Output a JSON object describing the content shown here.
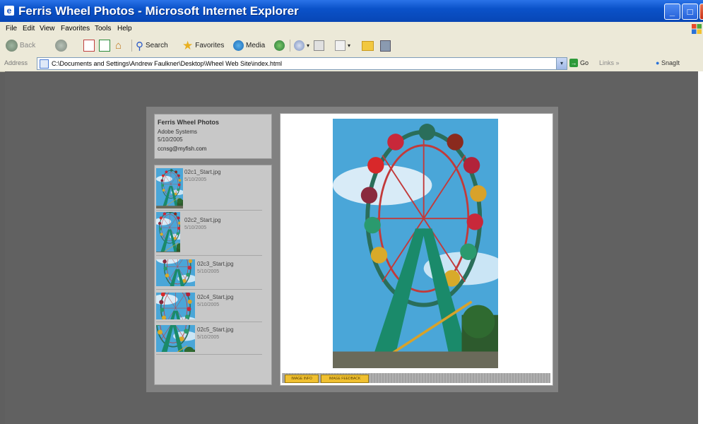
{
  "window": {
    "title": "Ferris Wheel Photos - Microsoft Internet Explorer",
    "title_icon": "e",
    "min_label": "_",
    "max_label": "□",
    "close_label": "X"
  },
  "menu": [
    "File",
    "Edit",
    "View",
    "Favorites",
    "Tools",
    "Help"
  ],
  "toolbar": {
    "back": "Back",
    "search": "Search",
    "favorites": "Favorites",
    "media": "Media"
  },
  "address": {
    "label": "Address",
    "url": "C:\\Documents and Settings\\Andrew Faulkner\\Desktop\\Wheel Web Site\\index.html",
    "go": "Go",
    "links": "Links",
    "snagit": "SnagIt"
  },
  "gallery": {
    "site_title": "Ferris Wheel Photos",
    "author": "Adobe Systems",
    "date": "5/10/2005",
    "email": "ccnsg@myfish.com",
    "thumbnails": [
      {
        "name": "02c1_Start.jpg",
        "date": "5/10/2005"
      },
      {
        "name": "02c2_Start.jpg",
        "date": "5/10/2005"
      },
      {
        "name": "02c3_Start.jpg",
        "date": "5/10/2005"
      },
      {
        "name": "02c4_Start.jpg",
        "date": "5/10/2005"
      },
      {
        "name": "02c5_Start.jpg",
        "date": "5/10/2005"
      }
    ],
    "buttons": {
      "image_info": "IMAGE INFO",
      "image_feedback": "IMAGE FEEDBACK"
    }
  },
  "colors": {
    "titlebar": "#0a52c9",
    "chrome": "#ece9d8",
    "background": "#616161",
    "button_yellow": "#f0c030"
  },
  "icons": [
    "back-icon",
    "forward-icon",
    "stop-icon",
    "refresh-icon",
    "home-icon",
    "search-icon",
    "favorites-star-icon",
    "media-icon",
    "history-icon",
    "mail-icon",
    "print-icon",
    "edit-icon",
    "folder-icon",
    "messenger-icon"
  ]
}
